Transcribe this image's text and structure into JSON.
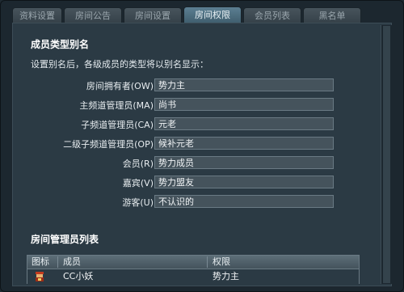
{
  "tabs": [
    {
      "label": "资料设置",
      "active": false
    },
    {
      "label": "房间公告",
      "active": false
    },
    {
      "label": "房间设置",
      "active": false
    },
    {
      "label": "房间权限",
      "active": true
    },
    {
      "label": "会员列表",
      "active": false
    },
    {
      "label": "黑名单",
      "active": false
    }
  ],
  "aliases": {
    "title": "成员类型别名",
    "description": "设置别名后，各级成员的类型将以别名显示：",
    "rows": [
      {
        "label": "房间拥有者(OW)",
        "value": "势力主"
      },
      {
        "label": "主频道管理员(MA)",
        "value": "尚书"
      },
      {
        "label": "子频道管理员(CA)",
        "value": "元老"
      },
      {
        "label": "二级子频道管理员(OP)",
        "value": "候补元老"
      },
      {
        "label": "会员(R)",
        "value": "势力成员"
      },
      {
        "label": "嘉宾(V)",
        "value": "势力盟友"
      },
      {
        "label": "游客(U)",
        "value": "不认识的"
      }
    ]
  },
  "admins": {
    "title": "房间管理员列表",
    "columns": [
      "图标",
      "成员",
      "权限"
    ],
    "rows": [
      {
        "icon": "member-avatar-icon",
        "member": "CC小妖",
        "permission": "势力主"
      }
    ]
  },
  "colors": {
    "accent": "#4f7486",
    "panel": "#2b3a44",
    "input": "#45535c"
  }
}
